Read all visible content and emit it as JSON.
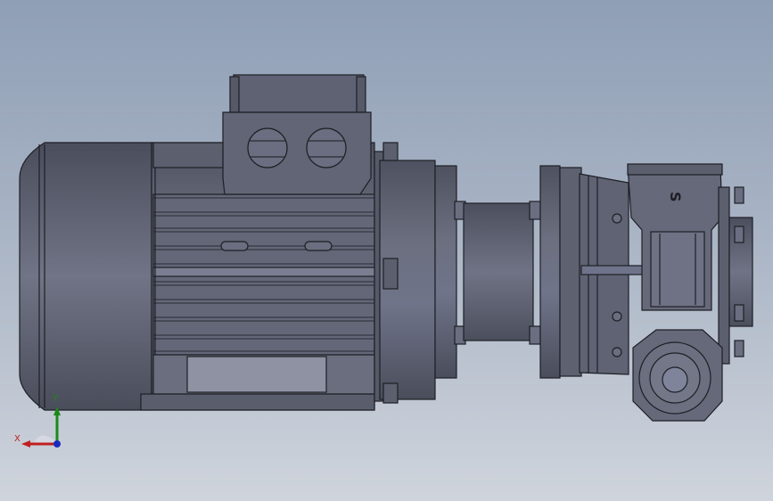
{
  "viewport": {
    "background_top": "#8f9fb6",
    "background_bottom": "#cfd4dc",
    "model_color": "#5f6372"
  },
  "model": {
    "pump_casing_marking": "S"
  },
  "triad": {
    "x_label": "X",
    "y_label": "Y",
    "x_color": "#c02020",
    "y_color": "#1a8a1a",
    "z_color": "#1a2ac0"
  }
}
